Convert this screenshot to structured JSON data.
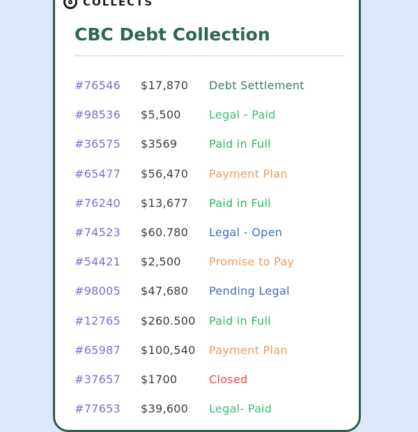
{
  "app": {
    "name": "COLLECTS"
  },
  "page": {
    "title": "CBC Debt Collection"
  },
  "status_colors": {
    "Debt Settlement": "#3f7a68",
    "Legal - Paid": "#34c07a",
    "Paid in Full": "#28b865",
    "Payment Plan": "#ef9a5a",
    "Legal - Open": "#3d6cc2",
    "Promise to Pay": "#ef9a5a",
    "Pending Legal": "#3d6cc2",
    "Closed": "#f04646",
    "Legal- Paid": "#34c07a"
  },
  "accounts": [
    {
      "id": "#76546",
      "amount": "$17,870",
      "status": "Debt Settlement"
    },
    {
      "id": "#98536",
      "amount": "$5,500",
      "status": "Legal - Paid"
    },
    {
      "id": "#36575",
      "amount": "$3569",
      "status": "Paid in Full"
    },
    {
      "id": "#65477",
      "amount": "$56,470",
      "status": "Payment Plan"
    },
    {
      "id": "#76240",
      "amount": "$13,677",
      "status": "Paid in Full"
    },
    {
      "id": "#74523",
      "amount": "$60.780",
      "status": "Legal - Open"
    },
    {
      "id": "#54421",
      "amount": "$2,500",
      "status": "Promise to Pay"
    },
    {
      "id": "#98005",
      "amount": "$47,680",
      "status": "Pending Legal"
    },
    {
      "id": "#12765",
      "amount": "$260.500",
      "status": "Paid in Full"
    },
    {
      "id": "#65987",
      "amount": "$100,540",
      "status": "Payment Plan"
    },
    {
      "id": "#37657",
      "amount": "$1700",
      "status": "Closed"
    },
    {
      "id": "#77653",
      "amount": "$39,600",
      "status": "Legal- Paid"
    }
  ]
}
